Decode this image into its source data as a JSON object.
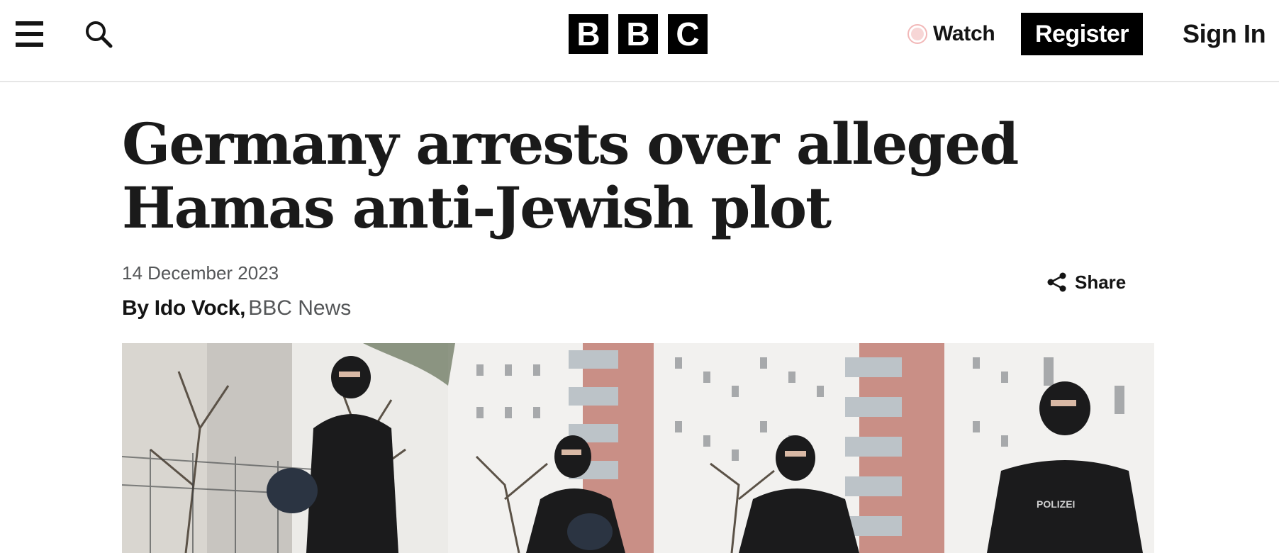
{
  "header": {
    "menu_icon": "hamburger-menu-icon",
    "search_icon": "search-icon",
    "logo_letters": [
      "B",
      "B",
      "C"
    ],
    "watch_label": "Watch",
    "register_label": "Register",
    "signin_label": "Sign In"
  },
  "article": {
    "headline": "Germany arrests over alleged Hamas anti-Jewish plot",
    "date": "14 December 2023",
    "author": "By Ido Vock,",
    "organization": "BBC News",
    "share_label": "Share",
    "share_icon": "share-icon",
    "hero_image": {
      "watermark_text": "POLIZEI"
    }
  },
  "colors": {
    "brand_black": "#000000",
    "text_primary": "#141414",
    "text_secondary": "#545658",
    "watch_dot": "#f2b8b8"
  }
}
